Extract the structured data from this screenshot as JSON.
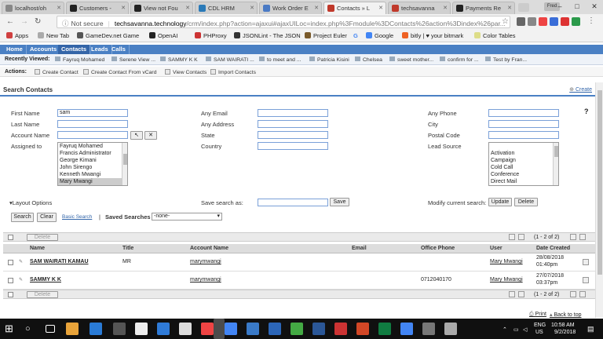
{
  "browser": {
    "tabs": [
      {
        "label": "localhost/oh",
        "color": "#888888"
      },
      {
        "label": "Customers -",
        "color": "#222222"
      },
      {
        "label": "View not Fou",
        "color": "#222222"
      },
      {
        "label": "CDL HRM",
        "color": "#2a7ab8"
      },
      {
        "label": "Work Order E",
        "color": "#4a7ac4"
      },
      {
        "label": "Contacts » L",
        "color": "#c0392b"
      },
      {
        "label": "techsavanna",
        "color": "#c0392b"
      },
      {
        "label": "Payments Re",
        "color": "#222222"
      }
    ],
    "user_badge": "Fred",
    "address": {
      "not_secure": "Not secure",
      "host": "techsavanna.technology",
      "path": "/crm/index.php?action=ajaxui#ajaxUILoc=index.php%3Fmodule%3DContacts%26action%3Dindex%26par..."
    },
    "bookmarks": [
      {
        "label": "Apps",
        "color": "#d04040"
      },
      {
        "label": "New Tab",
        "color": "#aaaaaa"
      },
      {
        "label": "GameDev.net Game",
        "color": "#555555"
      },
      {
        "label": "OpenAI",
        "color": "#222222"
      },
      {
        "label": "PHProxy",
        "color": "#cc3333"
      },
      {
        "label": "JSONLint - The JSON",
        "color": "#333333"
      },
      {
        "label": "Project Euler",
        "color": "#7a5a2a"
      },
      {
        "label": "G",
        "color": "#4285f4"
      },
      {
        "label": "Google",
        "color": "#4285f4"
      },
      {
        "label": "bitly | ♥ your bitmark",
        "color": "#ee6123"
      },
      {
        "label": "Color Tables",
        "color": "#dddd88"
      }
    ]
  },
  "crm": {
    "nav_tabs": [
      "Home",
      "Accounts",
      "Contacts",
      "Leads",
      "Calls"
    ],
    "recently_viewed_label": "Recently Viewed:",
    "recently_viewed": [
      "Fayruq Mohamed",
      "Serene View ...",
      "SAMMY K K",
      "SAM WAIRATI ...",
      "to meet and ...",
      "Patricia Kisini",
      "Chelsea",
      "sweet mother...",
      "confirm for ...",
      "Test by Fran..."
    ],
    "actions_label": "Actions:",
    "actions": [
      "Create Contact",
      "Create Contact From vCard",
      "View Contacts",
      "Import Contacts"
    ],
    "search": {
      "title": "Search Contacts",
      "create_label": "Create",
      "help": "?",
      "fields": {
        "first_name": {
          "label": "First Name",
          "value": "sam"
        },
        "last_name": {
          "label": "Last Name",
          "value": ""
        },
        "account_name": {
          "label": "Account Name",
          "value": ""
        },
        "assigned_to": {
          "label": "Assigned to"
        },
        "any_email": {
          "label": "Any Email",
          "value": ""
        },
        "any_address": {
          "label": "Any Address",
          "value": ""
        },
        "state": {
          "label": "State",
          "value": ""
        },
        "country": {
          "label": "Country",
          "value": ""
        },
        "any_phone": {
          "label": "Any Phone",
          "value": ""
        },
        "city": {
          "label": "City",
          "value": ""
        },
        "postal_code": {
          "label": "Postal Code",
          "value": ""
        },
        "lead_source": {
          "label": "Lead Source"
        }
      },
      "assigned_options": [
        "Fayruq Mohamed",
        "Francis Administrator",
        "George Kimani",
        "John Sirengo",
        "Kenneth Mwangi",
        "Mary Mwangi"
      ],
      "assigned_selected": "Mary Mwangi",
      "lead_source_options": [
        "",
        "Activation",
        "Campaign",
        "Cold Call",
        "Conference",
        "Direct Mail"
      ],
      "layout_options": "Layout Options",
      "save_search_label": "Save search as:",
      "save_button": "Save",
      "modify_label": "Modify current search:",
      "update_button": "Update",
      "delete_button": "Delete",
      "search_button": "Search",
      "clear_button": "Clear",
      "basic_search": "Basic Search",
      "saved_searches_label": "Saved Searches",
      "saved_searches_value": "-none-"
    },
    "results": {
      "delete_label": "Delete",
      "count_text": "(1 - 2 of 2)",
      "columns": [
        "Name",
        "Title",
        "Account Name",
        "Email",
        "Office Phone",
        "User",
        "Date Created"
      ],
      "rows": [
        {
          "name": "SAM WAIRATI KAMAU",
          "title": "MR",
          "account": "marymwangi",
          "email": "",
          "phone": "",
          "user": "Mary Mwangi",
          "date": "28/08/2018",
          "time": "01:40pm"
        },
        {
          "name": "SAMMY K K",
          "title": "",
          "account": "marymwangi",
          "email": "",
          "phone": "0712040170",
          "user": "Mary Mwangi",
          "date": "27/07/2018",
          "time": "03:37pm"
        }
      ],
      "print": "Print",
      "back_to_top": "Back to top"
    }
  },
  "taskbar": {
    "lang": "ENG",
    "region": "US",
    "time": "10:58 AM",
    "date": "9/2/2018"
  }
}
